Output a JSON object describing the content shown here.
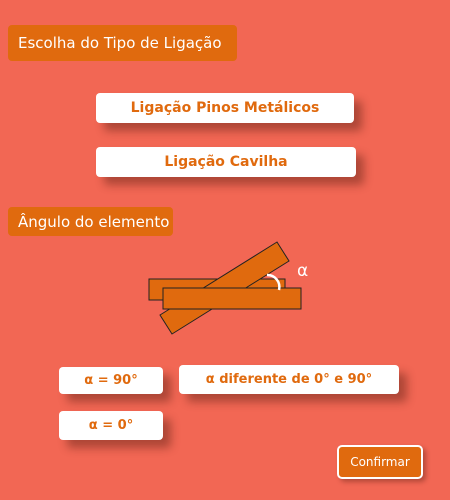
{
  "connection_type": {
    "heading": "Escolha do Tipo de Ligação",
    "options": [
      {
        "label": "Ligação Pinos Metálicos"
      },
      {
        "label": "Ligação Cavilha"
      }
    ]
  },
  "element_angle": {
    "heading": "Ângulo do elemento",
    "diagram_label": "α",
    "options": [
      {
        "label": "α = 90°"
      },
      {
        "label": "α diferente de 0° e 90°"
      },
      {
        "label": "α = 0°"
      }
    ]
  },
  "confirm_label": "Confirmar",
  "colors": {
    "background": "#f26754",
    "accent": "#e06a0e",
    "button_background": "#ffffff"
  }
}
